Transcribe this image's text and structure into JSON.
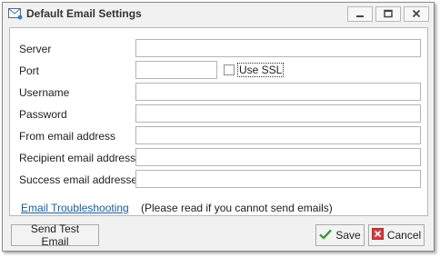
{
  "window": {
    "title": "Default Email Settings",
    "icon": "envelope-icon"
  },
  "form": {
    "server_label": "Server",
    "server_value": "",
    "port_label": "Port",
    "port_value": "",
    "use_ssl_label": "Use SSL",
    "use_ssl_checked": false,
    "username_label": "Username",
    "username_value": "",
    "password_label": "Password",
    "password_value": "",
    "from_label": "From email address",
    "from_value": "",
    "recipient_label": "Recipient email addresses",
    "recipient_value": "",
    "success_label": "Success email addresses",
    "success_value": ""
  },
  "help": {
    "link_text": "Email Troubleshooting",
    "note_text": "(Please read if you cannot send emails)"
  },
  "buttons": {
    "send_test": "Send Test Email",
    "save": "Save",
    "cancel": "Cancel"
  },
  "colors": {
    "link": "#1c5c9e",
    "save_icon": "#3a9a3a",
    "cancel_icon": "#d9363e"
  }
}
